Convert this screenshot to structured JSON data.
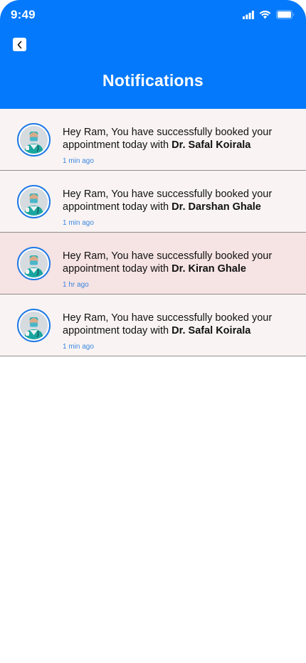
{
  "status_bar": {
    "time": "9:49",
    "icons": [
      "cellular-signal-icon",
      "wifi-icon",
      "battery-icon"
    ]
  },
  "header": {
    "title": "Notifications",
    "back_icon": "chevron-left-icon",
    "background_color": "#0479FB"
  },
  "notifications": [
    {
      "message": "Hey Ram, You have successfully booked your appointment today with ",
      "doctor": "Dr. Safal Koirala",
      "time": "1 min ago",
      "highlighted": false
    },
    {
      "message": "Hey Ram, You have successfully booked your appointment today with ",
      "doctor": "Dr. Darshan Ghale",
      "time": "1 min ago",
      "highlighted": false
    },
    {
      "message": "Hey Ram, You have successfully booked your appointment today with ",
      "doctor": "Dr. Kiran Ghale",
      "time": "1 hr ago",
      "highlighted": true
    },
    {
      "message": "Hey Ram, You have successfully booked your appointment today with ",
      "doctor": "Dr. Safal Koirala",
      "time": "1 min ago",
      "highlighted": false
    }
  ],
  "colors": {
    "card": "#F9F4F3",
    "card_highlight": "#F6E3E3",
    "time_text": "#3A86E0",
    "avatar_ring": "#1E78E6"
  }
}
